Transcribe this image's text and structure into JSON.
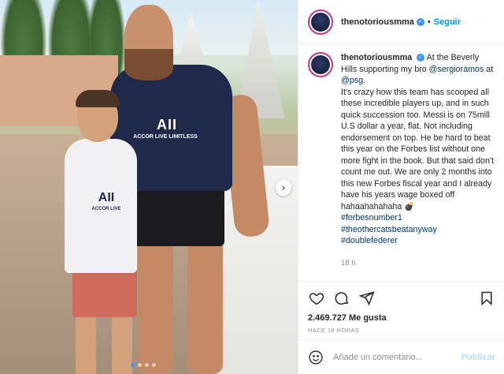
{
  "photo": {
    "shirt_text": "AII",
    "shirt_sub": "ACCOR LIVE LIMITLESS",
    "boy_shirt_text": "AII",
    "boy_shirt_sub": "ACCOR LIVE",
    "carousel": {
      "total": 4,
      "active_index": 0
    },
    "next_glyph": "›"
  },
  "header": {
    "username": "thenotoriousmma",
    "verified": "✓",
    "separator": "•",
    "follow_label": "Seguir",
    "more_glyph": "•••"
  },
  "caption": {
    "username": "thenotoriousmma",
    "verified": "✓",
    "text_1": "At the Beverly Hills supporting my bro ",
    "mention_1": "@sergioramos",
    "text_2": " at ",
    "mention_2": "@psg",
    "text_3": ".",
    "body": "It's crazy how this team has scooped all these incredible players up, and in such quick succession too. Messi is on 75mill U.S dollar a year, flat. Not including endorsement on top. He be hard to beat this year on the Forbes list without one more fight in the book. But that said don't count me out. We are only 2 months into this new Forbes fiscal year and I already have his years wage boxed off hahaahahahaha 💣",
    "hashtags": [
      "#forbesnumber1",
      "#theothercatsbeatanyway",
      "#doublefederer"
    ],
    "time": "18 h"
  },
  "actions": {
    "icons": [
      "heart-icon",
      "comment-icon",
      "share-icon",
      "bookmark-icon"
    ]
  },
  "likes": "2.469.727 Me gusta",
  "posted_ago": "HACE 18 HORAS",
  "comment_box": {
    "placeholder": "Añade un comentario...",
    "post_label": "Publicar"
  },
  "colors": {
    "accent": "#0095f6",
    "link": "#00376b",
    "muted": "#8e8e8e",
    "verified": "#3897f0",
    "post_disabled": "#b2dffc"
  }
}
